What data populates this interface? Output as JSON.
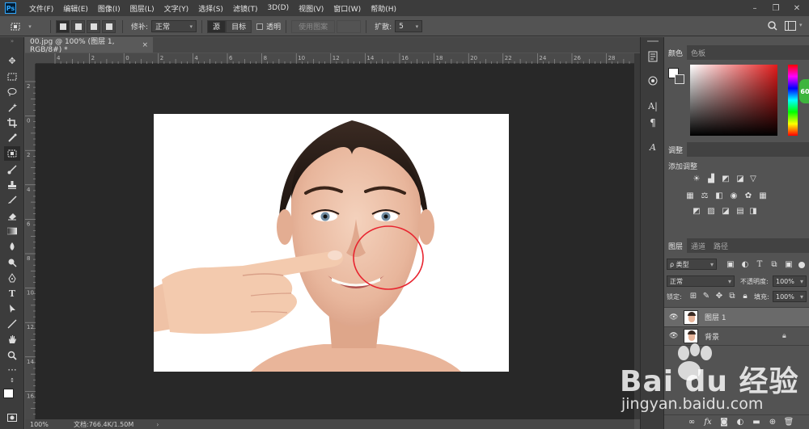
{
  "app": {
    "logo": "Ps"
  },
  "menu": [
    "文件(F)",
    "编辑(E)",
    "图像(I)",
    "图层(L)",
    "文字(Y)",
    "选择(S)",
    "滤镜(T)",
    "3D(D)",
    "视图(V)",
    "窗口(W)",
    "帮助(H)"
  ],
  "window_controls": {
    "minimize": "–",
    "restore": "❐",
    "close": "✕"
  },
  "options": {
    "patch_label": "修补:",
    "patch_mode": "正常",
    "source_label": "源",
    "target_label": "目标",
    "transparent_label": "透明",
    "use_pattern_label": "使用图案",
    "diffusion_label": "扩散:",
    "diffusion_value": "5"
  },
  "document": {
    "tab_title": "00.jpg @ 100% (图层 1, RGB/8#) *",
    "close_glyph": "×"
  },
  "ruler_h_labels": [
    "4",
    "2",
    "0",
    "2",
    "4",
    "6",
    "8",
    "10",
    "12",
    "14",
    "16",
    "18",
    "20",
    "22",
    "24",
    "26",
    "28"
  ],
  "ruler_v_labels": [
    "2",
    "0",
    "2",
    "4",
    "6",
    "8",
    "10",
    "12",
    "14",
    "16"
  ],
  "status": {
    "zoom": "100%",
    "doc_info": "文档:766.4K/1.50M"
  },
  "panels": {
    "color_tabs": [
      "颜色",
      "色板"
    ],
    "adjust_tab": "调整",
    "adjust_add": "添加调整",
    "layers_tabs": [
      "图层",
      "通道",
      "路径"
    ],
    "kind_label": "ρ 类型",
    "blend_mode": "正常",
    "opacity_label": "不透明度:",
    "opacity_value": "100%",
    "lock_label": "锁定:",
    "fill_label": "填充:",
    "fill_value": "100%",
    "layers": [
      {
        "name": "图层 1",
        "selected": true
      },
      {
        "name": "背景",
        "selected": false
      }
    ]
  },
  "watermark": {
    "brand": "Bai du 经验",
    "url": "jingyan.baidu.com"
  },
  "colors": {
    "accent": "#31a8ff",
    "selection_circle": "#e8242f",
    "canvas_bg": "#282828"
  }
}
